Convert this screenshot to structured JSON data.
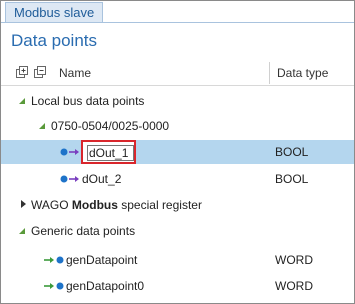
{
  "tab": {
    "label": "Modbus slave"
  },
  "page": {
    "title": "Data points"
  },
  "columns": {
    "name": "Name",
    "data_type": "Data type"
  },
  "tree": {
    "local_bus": {
      "label": "Local bus data points"
    },
    "module": {
      "label": "0750-0504/0025-0000"
    },
    "dout1": {
      "label": "dOut_1",
      "type": "BOOL"
    },
    "dout2": {
      "label": "dOut_2",
      "type": "BOOL"
    },
    "wago": {
      "label_brand": "WAGO",
      "label_bold": "Modbus",
      "label_rest": "special register"
    },
    "generic": {
      "label": "Generic data points"
    },
    "gen0": {
      "label": "genDatapoint",
      "type": "WORD"
    },
    "gen1": {
      "label": "genDatapoint0",
      "type": "WORD"
    }
  },
  "colors": {
    "accent": "#2a6cb0",
    "selection": "#b4d6ee",
    "highlight_border": "#d9262c",
    "expand_arrow": "#5a9a3a"
  }
}
